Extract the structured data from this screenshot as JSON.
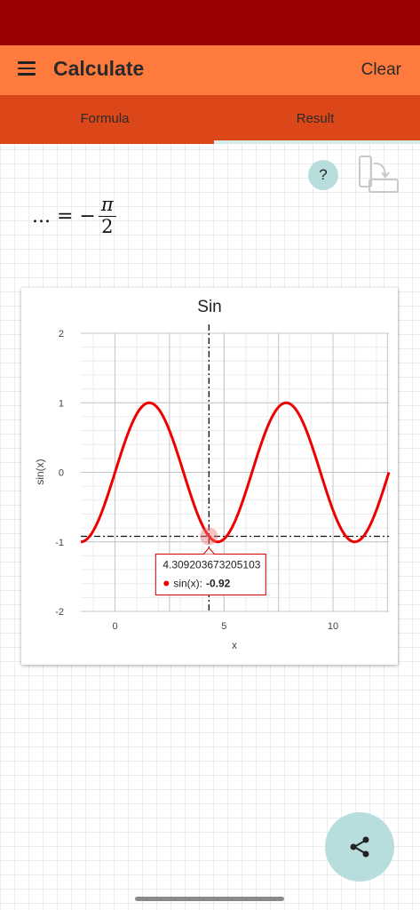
{
  "colors": {
    "status_bar": "#9b0000",
    "app_bar": "#ff7a3d",
    "tab_bar": "#dc4719",
    "tab_indicator": "#d7ece9",
    "accent_button": "#b7dedd",
    "series": "#ee0000"
  },
  "app_bar": {
    "menu_icon": "hamburger-menu-icon",
    "title": "Calculate",
    "clear_label": "Clear"
  },
  "tabs": [
    {
      "label": "Formula",
      "active": false
    },
    {
      "label": "Result",
      "active": true
    }
  ],
  "toolbar": {
    "help_label": "?",
    "rotate_icon": "screen-rotation-icon"
  },
  "result": {
    "lhs": "... = −",
    "numerator": "π",
    "denominator": "2"
  },
  "chart_data": {
    "type": "line",
    "title": "Sin",
    "xlabel": "x",
    "ylabel": "sin(x)",
    "xlim": [
      -1.5708,
      12.5664
    ],
    "ylim": [
      -2,
      2
    ],
    "xticks": [
      0,
      5,
      10
    ],
    "yticks": [
      -2,
      -1,
      0,
      1,
      2
    ],
    "grid": true,
    "series": [
      {
        "name": "sin(x)",
        "function": "sin(x)",
        "x": [
          -1.5708,
          0,
          1.5708,
          3.1416,
          4.7124,
          6.2832,
          7.854,
          9.4248,
          10.9956,
          12.5664
        ],
        "y": [
          -1,
          0,
          1,
          0,
          -1,
          0,
          1,
          0,
          -1,
          0
        ]
      }
    ],
    "crosshair": {
      "x": 4.309203673205103,
      "y": -0.92
    },
    "tooltip": {
      "x_text": "4.309203673205103",
      "series_label": "sin(x):",
      "value_text": "-0.92"
    }
  },
  "fab": {
    "icon": "share-icon"
  }
}
